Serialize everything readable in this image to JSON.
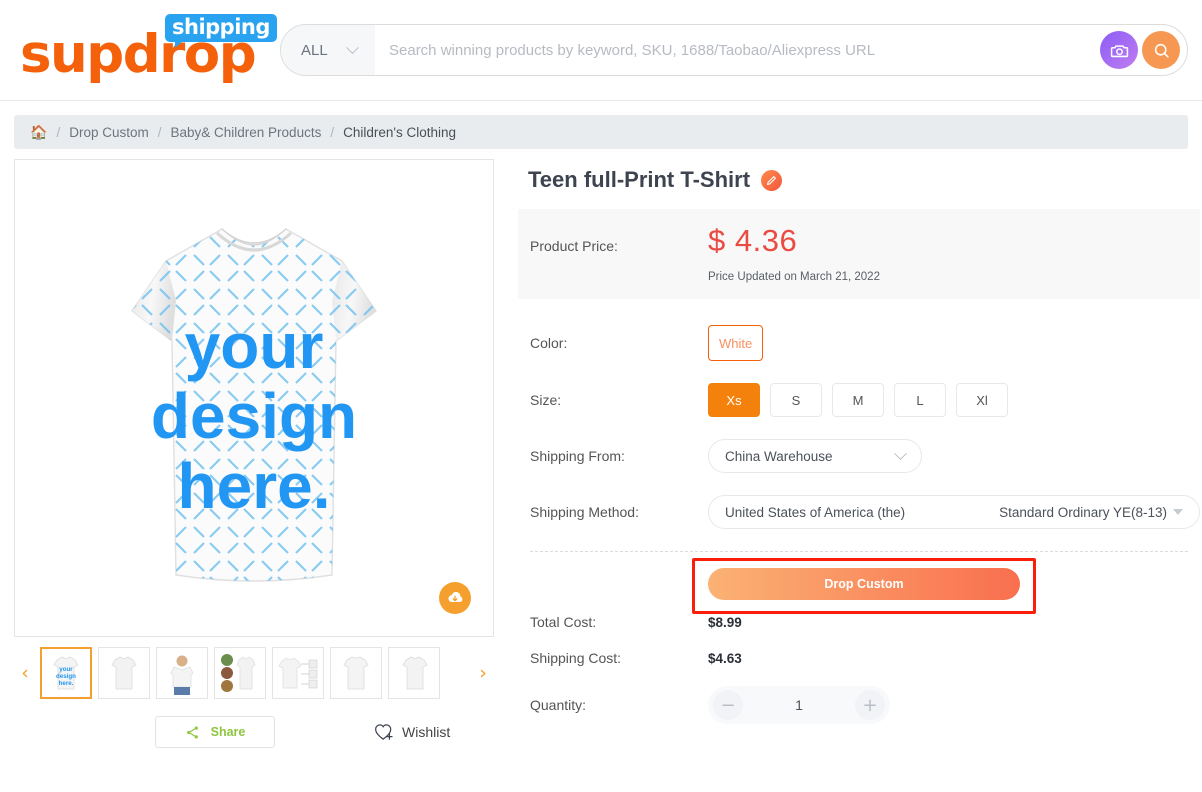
{
  "header": {
    "logo_word": "supdrop",
    "logo_badge": "shipping",
    "search": {
      "category": "ALL",
      "placeholder": "Search winning products by keyword, SKU, 1688/Taobao/Aliexpress URL",
      "value": "",
      "camera_icon": "camera-icon",
      "search_icon": "magnifier-icon"
    }
  },
  "breadcrumb": {
    "home_icon": "home-icon",
    "separator": "/",
    "items": [
      {
        "label": "Drop Custom"
      },
      {
        "label": "Baby& Children Products"
      },
      {
        "label": "Children's Clothing"
      }
    ]
  },
  "gallery": {
    "main_image_alt": "Teen full-Print T-Shirt white mockup with 'your design here.' text",
    "main_image_text_lines": [
      "your",
      "design",
      "here."
    ],
    "download_icon": "cloud-download-icon",
    "prev_arrow": "‹",
    "next_arrow": "›",
    "thumbnails": [
      {
        "name": "thumb-design-mockup",
        "selected": true
      },
      {
        "name": "thumb-plain-front",
        "selected": false
      },
      {
        "name": "thumb-model-wearing",
        "selected": false
      },
      {
        "name": "thumb-color-swatches",
        "selected": false
      },
      {
        "name": "thumb-size-diagram",
        "selected": false
      },
      {
        "name": "thumb-plain-back",
        "selected": false
      },
      {
        "name": "thumb-plain-angle",
        "selected": false
      }
    ],
    "share_label": "Share",
    "share_icon": "share-icon",
    "wishlist_label": "Wishlist",
    "wishlist_icon": "heart-plus-icon"
  },
  "product": {
    "title": "Teen full-Print T-Shirt",
    "edit_icon": "pencil-edit-icon",
    "price_label": "Product Price:",
    "price": "$ 4.36",
    "price_updated": "Price Updated on March 21, 2022",
    "color_label": "Color:",
    "colors": [
      {
        "label": "White",
        "selected": true
      }
    ],
    "size_label": "Size:",
    "sizes": [
      {
        "label": "Xs",
        "selected": true
      },
      {
        "label": "S",
        "selected": false
      },
      {
        "label": "M",
        "selected": false
      },
      {
        "label": "L",
        "selected": false
      },
      {
        "label": "Xl",
        "selected": false
      }
    ],
    "shipping_from_label": "Shipping From:",
    "shipping_from_value": "China Warehouse",
    "shipping_method_label": "Shipping Method:",
    "shipping_country": "United States of America (the)",
    "shipping_service": "Standard Ordinary YE(8-13)",
    "cta_label": "Drop Custom",
    "total_cost_label": "Total Cost:",
    "total_cost": "$8.99",
    "shipping_cost_label": "Shipping Cost:",
    "shipping_cost": "$4.63",
    "quantity_label": "Quantity:",
    "quantity": "1",
    "qty_minus": "−",
    "qty_plus": "+"
  },
  "colors": {
    "brand_orange": "#f4610a",
    "badge_blue": "#29a3ef",
    "price_red": "#ea4b42",
    "selected_orange": "#f4810c",
    "annotation_red": "#fa1f0a",
    "share_green": "#8dc63f"
  }
}
